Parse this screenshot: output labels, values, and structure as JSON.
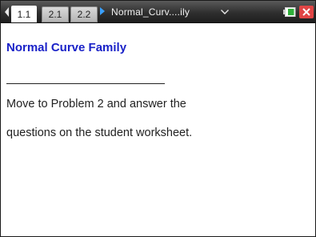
{
  "tabs": [
    {
      "label": "1.1",
      "active": true
    },
    {
      "label": "2.1",
      "active": false
    },
    {
      "label": "2.2",
      "active": false
    }
  ],
  "document": {
    "title": "Normal_Curv....ily"
  },
  "icons": {
    "nav_left": "left-arrow-icon",
    "nav_right": "right-arrow-icon",
    "menu": "chevron-down-icon",
    "battery": "battery-icon",
    "close": "close-icon"
  },
  "colors": {
    "heading": "#1a22c8",
    "nav_arrow": "#39a0ff",
    "close": "#e04545",
    "battery": "#2fae3a"
  },
  "page": {
    "heading": "Normal Curve Family",
    "lines": [
      "Move to Problem 2 and answer the",
      "questions on the student worksheet."
    ]
  }
}
